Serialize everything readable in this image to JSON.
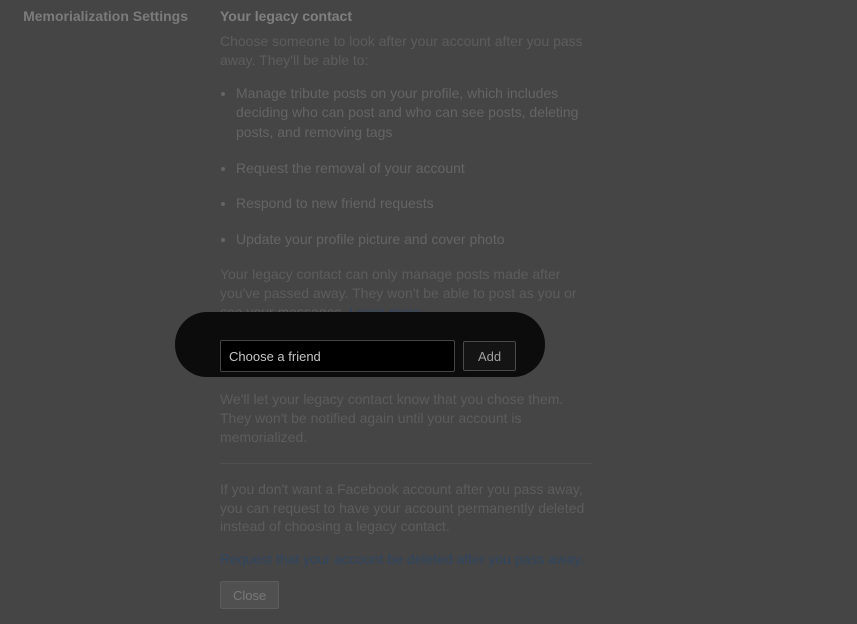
{
  "left": {
    "label": "Memorialization Settings"
  },
  "section": {
    "title": "Your legacy contact",
    "intro": "Choose someone to look after your account after you pass away. They'll be able to:",
    "bullets": [
      "Manage tribute posts on your profile, which includes deciding who can post and who can see posts, deleting posts, and removing tags",
      "Request the removal of your account",
      "Respond to new friend requests",
      "Update your profile picture and cover photo"
    ],
    "limits_prefix": "Your legacy contact can only manage posts made after you've passed away. They won't be able to post as you or see your messages. ",
    "learn_more": "Learn more",
    "friend_placeholder": "Choose a friend",
    "add_label": "Add",
    "notice": "We'll let your legacy contact know that you chose them. They won't be notified again until your account is memorialized.",
    "delete_info": "If you don't want a Facebook account after you pass away, you can request to have your account permanently deleted instead of choosing a legacy contact.",
    "delete_link": "Request that your account be deleted after you pass away.",
    "close_label": "Close"
  }
}
